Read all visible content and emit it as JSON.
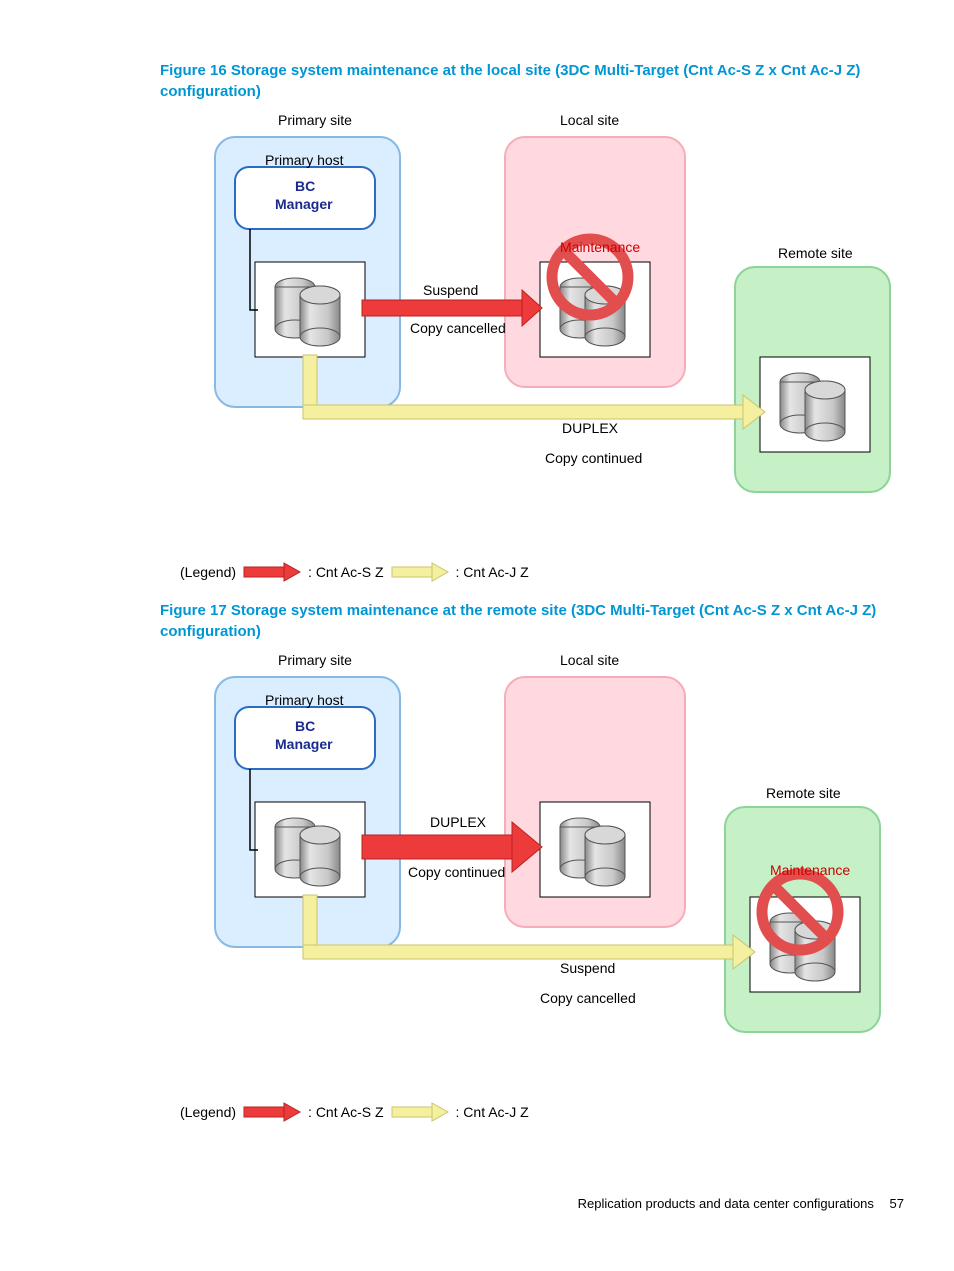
{
  "figure16": {
    "caption": "Figure 16 Storage system maintenance at the local site (3DC Multi-Target (Cnt Ac-S Z x Cnt Ac-J Z) configuration)",
    "primary_site": "Primary site",
    "primary_host": "Primary host",
    "bc_manager": "BC Manager",
    "local_site": "Local site",
    "remote_site": "Remote site",
    "maintenance": "Maintenance",
    "suspend": "Suspend",
    "copy_cancelled": "Copy cancelled",
    "duplex": "DUPLEX",
    "copy_continued": "Copy continued",
    "legend_label": "(Legend)",
    "legend_acs": ": Cnt Ac-S Z",
    "legend_acj": ": Cnt Ac-J Z"
  },
  "figure17": {
    "caption": "Figure 17 Storage system maintenance at the remote site (3DC Multi-Target (Cnt Ac-S Z x Cnt Ac-J Z) configuration)",
    "primary_site": "Primary site",
    "primary_host": "Primary host",
    "bc_manager": "BC Manager",
    "local_site": "Local site",
    "remote_site": "Remote site",
    "maintenance": "Maintenance",
    "duplex": "DUPLEX",
    "copy_continued": "Copy continued",
    "suspend": "Suspend",
    "copy_cancelled": "Copy cancelled",
    "legend_label": "(Legend)",
    "legend_acs": ": Cnt Ac-S Z",
    "legend_acj": ": Cnt Ac-J Z"
  },
  "footer": {
    "text": "Replication products and data center configurations",
    "page": "57"
  },
  "colors": {
    "caption": "#0096d6",
    "primary_fill": "#dbeeff",
    "primary_stroke": "#87b9e5",
    "local_fill": "#ffd9df",
    "local_stroke": "#f5aeb8",
    "remote_fill": "#c6f0c6",
    "remote_stroke": "#8ed49a",
    "red_arrow": "#ed3a3a",
    "yellow_arrow": "#f4f0a0",
    "host_stroke": "#2a6cc2",
    "host_text": "#1a2a8e"
  }
}
